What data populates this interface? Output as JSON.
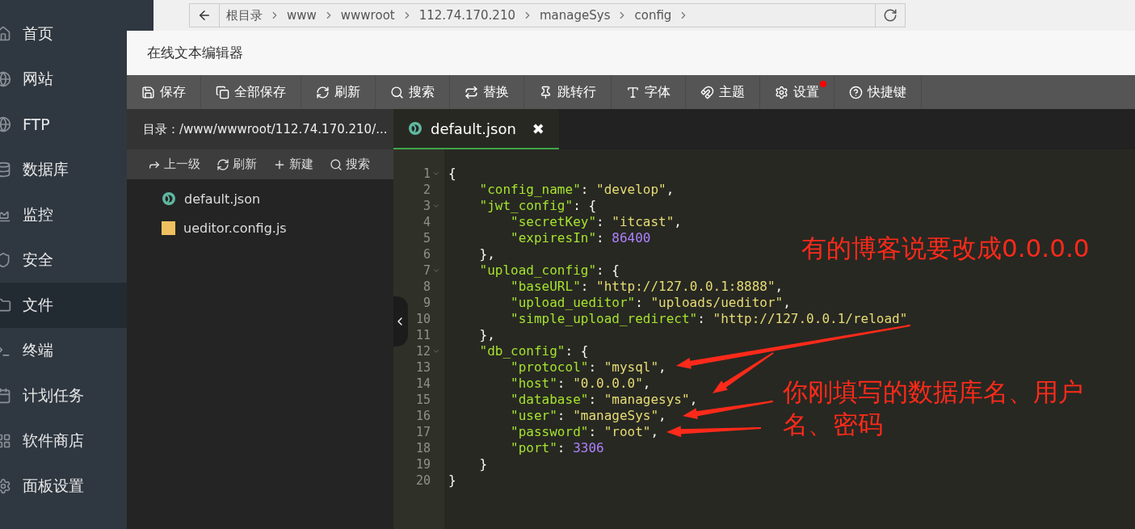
{
  "sidebar": {
    "items": [
      {
        "label": "首页",
        "selected": false
      },
      {
        "label": "网站",
        "selected": false
      },
      {
        "label": "FTP",
        "selected": false
      },
      {
        "label": "数据库",
        "selected": false
      },
      {
        "label": "监控",
        "selected": false
      },
      {
        "label": "安全",
        "selected": false
      },
      {
        "label": "文件",
        "selected": true
      },
      {
        "label": "终端",
        "selected": false
      },
      {
        "label": "计划任务",
        "selected": false
      },
      {
        "label": "软件商店",
        "selected": false
      },
      {
        "label": "面板设置",
        "selected": false
      }
    ]
  },
  "breadcrumb": [
    "根目录",
    "www",
    "wwwroot",
    "112.74.170.210",
    "manageSys",
    "config"
  ],
  "dialog": {
    "title": "在线文本编辑器",
    "toolbar": [
      {
        "label": "保存",
        "notify": false
      },
      {
        "label": "全部保存",
        "notify": false
      },
      {
        "label": "刷新",
        "notify": false
      },
      {
        "label": "搜索",
        "notify": false
      },
      {
        "label": "替换",
        "notify": false
      },
      {
        "label": "跳转行",
        "notify": false
      },
      {
        "label": "字体",
        "notify": false
      },
      {
        "label": "主题",
        "notify": false
      },
      {
        "label": "设置",
        "notify": true
      },
      {
        "label": "快捷键",
        "notify": false
      }
    ],
    "file_panel": {
      "directory": "目录：/www/wwwroot/112.74.170.210/...",
      "actions": [
        "上一级",
        "刷新",
        "新建",
        "搜索"
      ],
      "files": [
        {
          "name": "default.json",
          "kind": "json"
        },
        {
          "name": "ueditor.config.js",
          "kind": "js"
        }
      ]
    },
    "editor": {
      "tab": {
        "name": "default.json",
        "close": "✖"
      },
      "lines": [
        {
          "number": "1",
          "fold": true,
          "tokens": [
            {
              "kind": "punct",
              "text": "{"
            }
          ]
        },
        {
          "number": "2",
          "fold": false,
          "tokens": [
            {
              "kind": "key",
              "text": "    \"config_name\""
            },
            {
              "kind": "punct",
              "text": ": "
            },
            {
              "kind": "string",
              "text": "\"develop\""
            },
            {
              "kind": "punct",
              "text": ","
            }
          ]
        },
        {
          "number": "3",
          "fold": true,
          "tokens": [
            {
              "kind": "key",
              "text": "    \"jwt_config\""
            },
            {
              "kind": "punct",
              "text": ": {"
            }
          ]
        },
        {
          "number": "4",
          "fold": false,
          "tokens": [
            {
              "kind": "key",
              "text": "        \"secretKey\""
            },
            {
              "kind": "punct",
              "text": ": "
            },
            {
              "kind": "string",
              "text": "\"itcast\""
            },
            {
              "kind": "punct",
              "text": ","
            }
          ]
        },
        {
          "number": "5",
          "fold": false,
          "tokens": [
            {
              "kind": "key",
              "text": "        \"expiresIn\""
            },
            {
              "kind": "punct",
              "text": ": "
            },
            {
              "kind": "number",
              "text": "86400"
            }
          ]
        },
        {
          "number": "6",
          "fold": false,
          "tokens": [
            {
              "kind": "punct",
              "text": "    },"
            }
          ]
        },
        {
          "number": "7",
          "fold": true,
          "tokens": [
            {
              "kind": "key",
              "text": "    \"upload_config\""
            },
            {
              "kind": "punct",
              "text": ": {"
            }
          ]
        },
        {
          "number": "8",
          "fold": false,
          "tokens": [
            {
              "kind": "key",
              "text": "        \"baseURL\""
            },
            {
              "kind": "punct",
              "text": ": "
            },
            {
              "kind": "string",
              "text": "\"http://127.0.0.1:8888\""
            },
            {
              "kind": "punct",
              "text": ","
            }
          ]
        },
        {
          "number": "9",
          "fold": false,
          "tokens": [
            {
              "kind": "key",
              "text": "        \"upload_ueditor\""
            },
            {
              "kind": "punct",
              "text": ": "
            },
            {
              "kind": "string",
              "text": "\"uploads/ueditor\""
            },
            {
              "kind": "punct",
              "text": ","
            }
          ]
        },
        {
          "number": "10",
          "fold": false,
          "tokens": [
            {
              "kind": "key",
              "text": "        \"simple_upload_redirect\""
            },
            {
              "kind": "punct",
              "text": ": "
            },
            {
              "kind": "string",
              "text": "\"http://127.0.0.1/reload\""
            }
          ]
        },
        {
          "number": "11",
          "fold": false,
          "tokens": [
            {
              "kind": "punct",
              "text": "    },"
            }
          ]
        },
        {
          "number": "12",
          "fold": true,
          "tokens": [
            {
              "kind": "key",
              "text": "    \"db_config\""
            },
            {
              "kind": "punct",
              "text": ": {"
            }
          ]
        },
        {
          "number": "13",
          "fold": false,
          "tokens": [
            {
              "kind": "key",
              "text": "        \"protocol\""
            },
            {
              "kind": "punct",
              "text": ": "
            },
            {
              "kind": "string",
              "text": "\"mysql\""
            },
            {
              "kind": "punct",
              "text": ","
            }
          ]
        },
        {
          "number": "14",
          "fold": false,
          "tokens": [
            {
              "kind": "key",
              "text": "        \"host\""
            },
            {
              "kind": "punct",
              "text": ": "
            },
            {
              "kind": "string",
              "text": "\"0.0.0.0\""
            },
            {
              "kind": "punct",
              "text": ","
            }
          ]
        },
        {
          "number": "15",
          "fold": false,
          "tokens": [
            {
              "kind": "key",
              "text": "        \"database\""
            },
            {
              "kind": "punct",
              "text": ": "
            },
            {
              "kind": "string",
              "text": "\"managesys\""
            },
            {
              "kind": "punct",
              "text": ","
            }
          ]
        },
        {
          "number": "16",
          "fold": false,
          "tokens": [
            {
              "kind": "key",
              "text": "        \"user\""
            },
            {
              "kind": "punct",
              "text": ": "
            },
            {
              "kind": "string",
              "text": "\"manageSys\""
            },
            {
              "kind": "punct",
              "text": ","
            }
          ]
        },
        {
          "number": "17",
          "fold": false,
          "tokens": [
            {
              "kind": "key",
              "text": "        \"password\""
            },
            {
              "kind": "punct",
              "text": ": "
            },
            {
              "kind": "string",
              "text": "\"root\""
            },
            {
              "kind": "punct",
              "text": ","
            }
          ]
        },
        {
          "number": "18",
          "fold": false,
          "tokens": [
            {
              "kind": "key",
              "text": "        \"port\""
            },
            {
              "kind": "punct",
              "text": ": "
            },
            {
              "kind": "number",
              "text": "3306"
            }
          ]
        },
        {
          "number": "19",
          "fold": false,
          "tokens": [
            {
              "kind": "punct",
              "text": "    }"
            }
          ]
        },
        {
          "number": "20",
          "fold": false,
          "tokens": [
            {
              "kind": "punct",
              "text": "}"
            }
          ]
        }
      ]
    },
    "annotations": [
      "有的博客说要改成0.0.0.0",
      "你刚填写的数据库名、用户名、密码"
    ]
  }
}
